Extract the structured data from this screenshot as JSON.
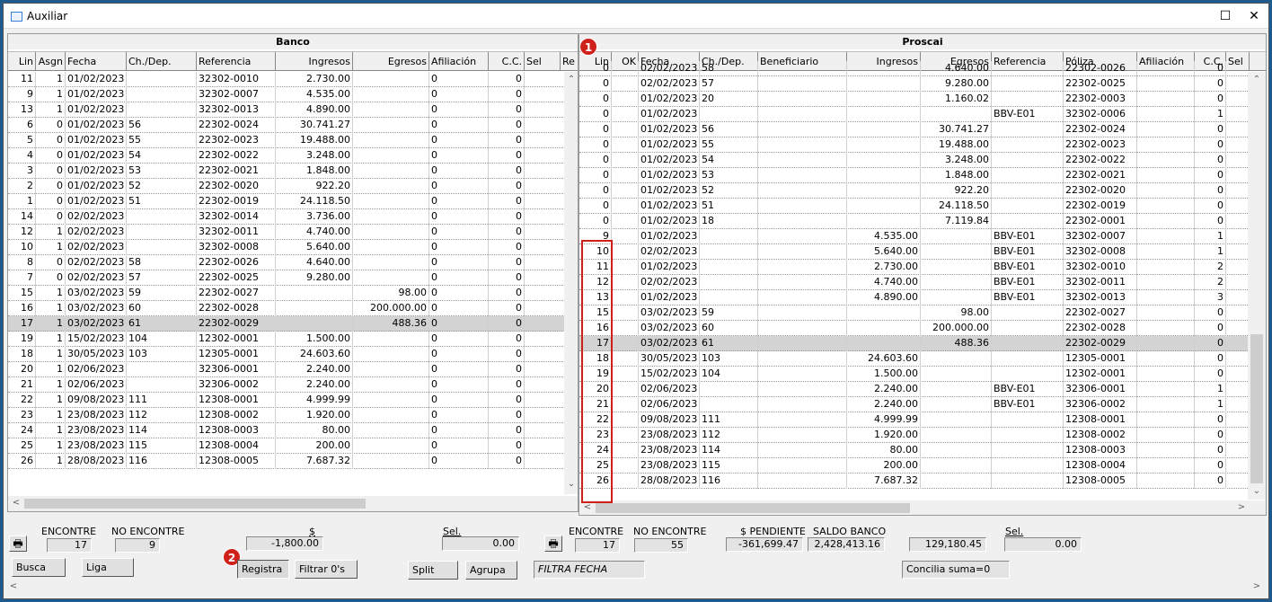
{
  "window": {
    "title": "Auxiliar",
    "minimize": "☐",
    "close": "✕"
  },
  "banco": {
    "title": "Banco",
    "columns": [
      "Lin",
      "Asgn",
      "Fecha",
      "Ch./Dep.",
      "Referencia",
      "Ingresos",
      "Egresos",
      "Afiliación",
      "C.C.",
      "Sel",
      "Re"
    ],
    "rows": [
      [
        "11",
        "1",
        "01/02/2023",
        "",
        "32302-0010",
        "2.730.00",
        "",
        "0",
        "0"
      ],
      [
        "9",
        "1",
        "01/02/2023",
        "",
        "32302-0007",
        "4.535.00",
        "",
        "0",
        "0"
      ],
      [
        "13",
        "1",
        "01/02/2023",
        "",
        "32302-0013",
        "4.890.00",
        "",
        "0",
        "0"
      ],
      [
        "6",
        "0",
        "01/02/2023",
        "56",
        "22302-0024",
        "30.741.27",
        "",
        "0",
        "0"
      ],
      [
        "5",
        "0",
        "01/02/2023",
        "55",
        "22302-0023",
        "19.488.00",
        "",
        "0",
        "0"
      ],
      [
        "4",
        "0",
        "01/02/2023",
        "54",
        "22302-0022",
        "3.248.00",
        "",
        "0",
        "0"
      ],
      [
        "3",
        "0",
        "01/02/2023",
        "53",
        "22302-0021",
        "1.848.00",
        "",
        "0",
        "0"
      ],
      [
        "2",
        "0",
        "01/02/2023",
        "52",
        "22302-0020",
        "922.20",
        "",
        "0",
        "0"
      ],
      [
        "1",
        "0",
        "01/02/2023",
        "51",
        "22302-0019",
        "24.118.50",
        "",
        "0",
        "0"
      ],
      [
        "14",
        "0",
        "02/02/2023",
        "",
        "32302-0014",
        "3.736.00",
        "",
        "0",
        "0"
      ],
      [
        "12",
        "1",
        "02/02/2023",
        "",
        "32302-0011",
        "4.740.00",
        "",
        "0",
        "0"
      ],
      [
        "10",
        "1",
        "02/02/2023",
        "",
        "32302-0008",
        "5.640.00",
        "",
        "0",
        "0"
      ],
      [
        "8",
        "0",
        "02/02/2023",
        "58",
        "22302-0026",
        "4.640.00",
        "",
        "0",
        "0"
      ],
      [
        "7",
        "0",
        "02/02/2023",
        "57",
        "22302-0025",
        "9.280.00",
        "",
        "0",
        "0"
      ],
      [
        "15",
        "1",
        "03/02/2023",
        "59",
        "22302-0027",
        "",
        "98.00",
        "0",
        "0"
      ],
      [
        "16",
        "1",
        "03/02/2023",
        "60",
        "22302-0028",
        "",
        "200.000.00",
        "0",
        "0"
      ],
      [
        "17",
        "1",
        "03/02/2023",
        "61",
        "22302-0029",
        "",
        "488.36",
        "0",
        "0"
      ],
      [
        "19",
        "1",
        "15/02/2023",
        "104",
        "12302-0001",
        "1.500.00",
        "",
        "0",
        "0"
      ],
      [
        "18",
        "1",
        "30/05/2023",
        "103",
        "12305-0001",
        "24.603.60",
        "",
        "0",
        "0"
      ],
      [
        "20",
        "1",
        "02/06/2023",
        "",
        "32306-0001",
        "2.240.00",
        "",
        "0",
        "0"
      ],
      [
        "21",
        "1",
        "02/06/2023",
        "",
        "32306-0002",
        "2.240.00",
        "",
        "0",
        "0"
      ],
      [
        "22",
        "1",
        "09/08/2023",
        "111",
        "12308-0001",
        "4.999.99",
        "",
        "0",
        "0"
      ],
      [
        "23",
        "1",
        "23/08/2023",
        "112",
        "12308-0002",
        "1.920.00",
        "",
        "0",
        "0"
      ],
      [
        "24",
        "1",
        "23/08/2023",
        "114",
        "12308-0003",
        "80.00",
        "",
        "0",
        "0"
      ],
      [
        "25",
        "1",
        "23/08/2023",
        "115",
        "12308-0004",
        "200.00",
        "",
        "0",
        "0"
      ],
      [
        "26",
        "1",
        "28/08/2023",
        "116",
        "12308-0005",
        "7.687.32",
        "",
        "0",
        "0"
      ]
    ],
    "selected_row": 16
  },
  "proscai": {
    "title": "Proscai",
    "columns": [
      "Lin",
      "OK",
      "Fecha",
      "Ch./Dep.",
      "Beneficiario",
      "Ingresos",
      "Egresos",
      "Referencia",
      "Póliza",
      "Afiliación",
      "C.C.",
      "Sel"
    ],
    "partial_row": [
      "0",
      "",
      "02/02/2023",
      "58",
      "",
      "",
      "4.640.00",
      "",
      "22302-0026",
      "",
      "0"
    ],
    "rows": [
      [
        "0",
        "",
        "02/02/2023",
        "57",
        "",
        "",
        "9.280.00",
        "",
        "22302-0025",
        "",
        "0"
      ],
      [
        "0",
        "",
        "01/02/2023",
        "20",
        "",
        "",
        "1.160.02",
        "",
        "22302-0003",
        "",
        "0"
      ],
      [
        "0",
        "",
        "01/02/2023",
        "",
        "",
        "",
        "",
        "BBV-E01",
        "32302-0006",
        "",
        "1"
      ],
      [
        "0",
        "",
        "01/02/2023",
        "56",
        "",
        "",
        "30.741.27",
        "",
        "22302-0024",
        "",
        "0"
      ],
      [
        "0",
        "",
        "01/02/2023",
        "55",
        "",
        "",
        "19.488.00",
        "",
        "22302-0023",
        "",
        "0"
      ],
      [
        "0",
        "",
        "01/02/2023",
        "54",
        "",
        "",
        "3.248.00",
        "",
        "22302-0022",
        "",
        "0"
      ],
      [
        "0",
        "",
        "01/02/2023",
        "53",
        "",
        "",
        "1.848.00",
        "",
        "22302-0021",
        "",
        "0"
      ],
      [
        "0",
        "",
        "01/02/2023",
        "52",
        "",
        "",
        "922.20",
        "",
        "22302-0020",
        "",
        "0"
      ],
      [
        "0",
        "",
        "01/02/2023",
        "51",
        "",
        "",
        "24.118.50",
        "",
        "22302-0019",
        "",
        "0"
      ],
      [
        "0",
        "",
        "01/02/2023",
        "18",
        "",
        "",
        "7.119.84",
        "",
        "22302-0001",
        "",
        "0"
      ],
      [
        "9",
        "",
        "01/02/2023",
        "",
        "",
        "4.535.00",
        "",
        "BBV-E01",
        "32302-0007",
        "",
        "1"
      ],
      [
        "10",
        "",
        "02/02/2023",
        "",
        "",
        "5.640.00",
        "",
        "BBV-E01",
        "32302-0008",
        "",
        "1"
      ],
      [
        "11",
        "",
        "01/02/2023",
        "",
        "",
        "2.730.00",
        "",
        "BBV-E01",
        "32302-0010",
        "",
        "2"
      ],
      [
        "12",
        "",
        "02/02/2023",
        "",
        "",
        "4.740.00",
        "",
        "BBV-E01",
        "32302-0011",
        "",
        "2"
      ],
      [
        "13",
        "",
        "01/02/2023",
        "",
        "",
        "4.890.00",
        "",
        "BBV-E01",
        "32302-0013",
        "",
        "3"
      ],
      [
        "15",
        "",
        "03/02/2023",
        "59",
        "",
        "",
        "98.00",
        "",
        "22302-0027",
        "",
        "0"
      ],
      [
        "16",
        "",
        "03/02/2023",
        "60",
        "",
        "",
        "200.000.00",
        "",
        "22302-0028",
        "",
        "0"
      ],
      [
        "17",
        "",
        "03/02/2023",
        "61",
        "",
        "",
        "488.36",
        "",
        "22302-0029",
        "",
        "0"
      ],
      [
        "18",
        "",
        "30/05/2023",
        "103",
        "",
        "24.603.60",
        "",
        "",
        "12305-0001",
        "",
        "0"
      ],
      [
        "19",
        "",
        "15/02/2023",
        "104",
        "",
        "1.500.00",
        "",
        "",
        "12302-0001",
        "",
        "0"
      ],
      [
        "20",
        "",
        "02/06/2023",
        "",
        "",
        "2.240.00",
        "",
        "BBV-E01",
        "32306-0001",
        "",
        "1"
      ],
      [
        "21",
        "",
        "02/06/2023",
        "",
        "",
        "2.240.00",
        "",
        "BBV-E01",
        "32306-0002",
        "",
        "1"
      ],
      [
        "22",
        "",
        "09/08/2023",
        "111",
        "",
        "4.999.99",
        "",
        "",
        "12308-0001",
        "",
        "0"
      ],
      [
        "23",
        "",
        "23/08/2023",
        "112",
        "",
        "1.920.00",
        "",
        "",
        "12308-0002",
        "",
        "0"
      ],
      [
        "24",
        "",
        "23/08/2023",
        "114",
        "",
        "80.00",
        "",
        "",
        "12308-0003",
        "",
        "0"
      ],
      [
        "25",
        "",
        "23/08/2023",
        "115",
        "",
        "200.00",
        "",
        "",
        "12308-0004",
        "",
        "0"
      ],
      [
        "26",
        "",
        "28/08/2023",
        "116",
        "",
        "7.687.32",
        "",
        "",
        "12308-0005",
        "",
        "0"
      ]
    ],
    "selected_row": 17
  },
  "footer": {
    "encontre_label": "ENCONTRE",
    "no_encontre_label": "NO ENCONTRE",
    "dollar_label": "$",
    "sel_label": "Sel.",
    "left_encontre": "17",
    "left_no_encontre": "9",
    "left_dollar": "-1,800.00",
    "left_sel": "0.00",
    "pendiente_label": "$ PENDIENTE",
    "saldo_label": "SALDO BANCO",
    "right_encontre": "17",
    "right_no_encontre": "55",
    "right_pendiente": "-361,699.47",
    "right_saldo": "2,428,413.16",
    "right_extra": "129,180.45",
    "right_sel": "0.00",
    "btn_busca": "Busca",
    "btn_liga": "Liga",
    "btn_registra": "Registra",
    "btn_filtrar": "Filtrar 0's",
    "btn_split": "Split",
    "btn_agrupa": "Agrupa",
    "filtra_fecha": "FILTRA FECHA",
    "concilia": "Concilia suma=0"
  },
  "annotations": {
    "badge1": "1",
    "badge2": "2"
  },
  "colors": {
    "annotation_red": "#d0201a",
    "selected_row": "#d3d3d3"
  },
  "icons": {
    "printer": "🖶"
  }
}
